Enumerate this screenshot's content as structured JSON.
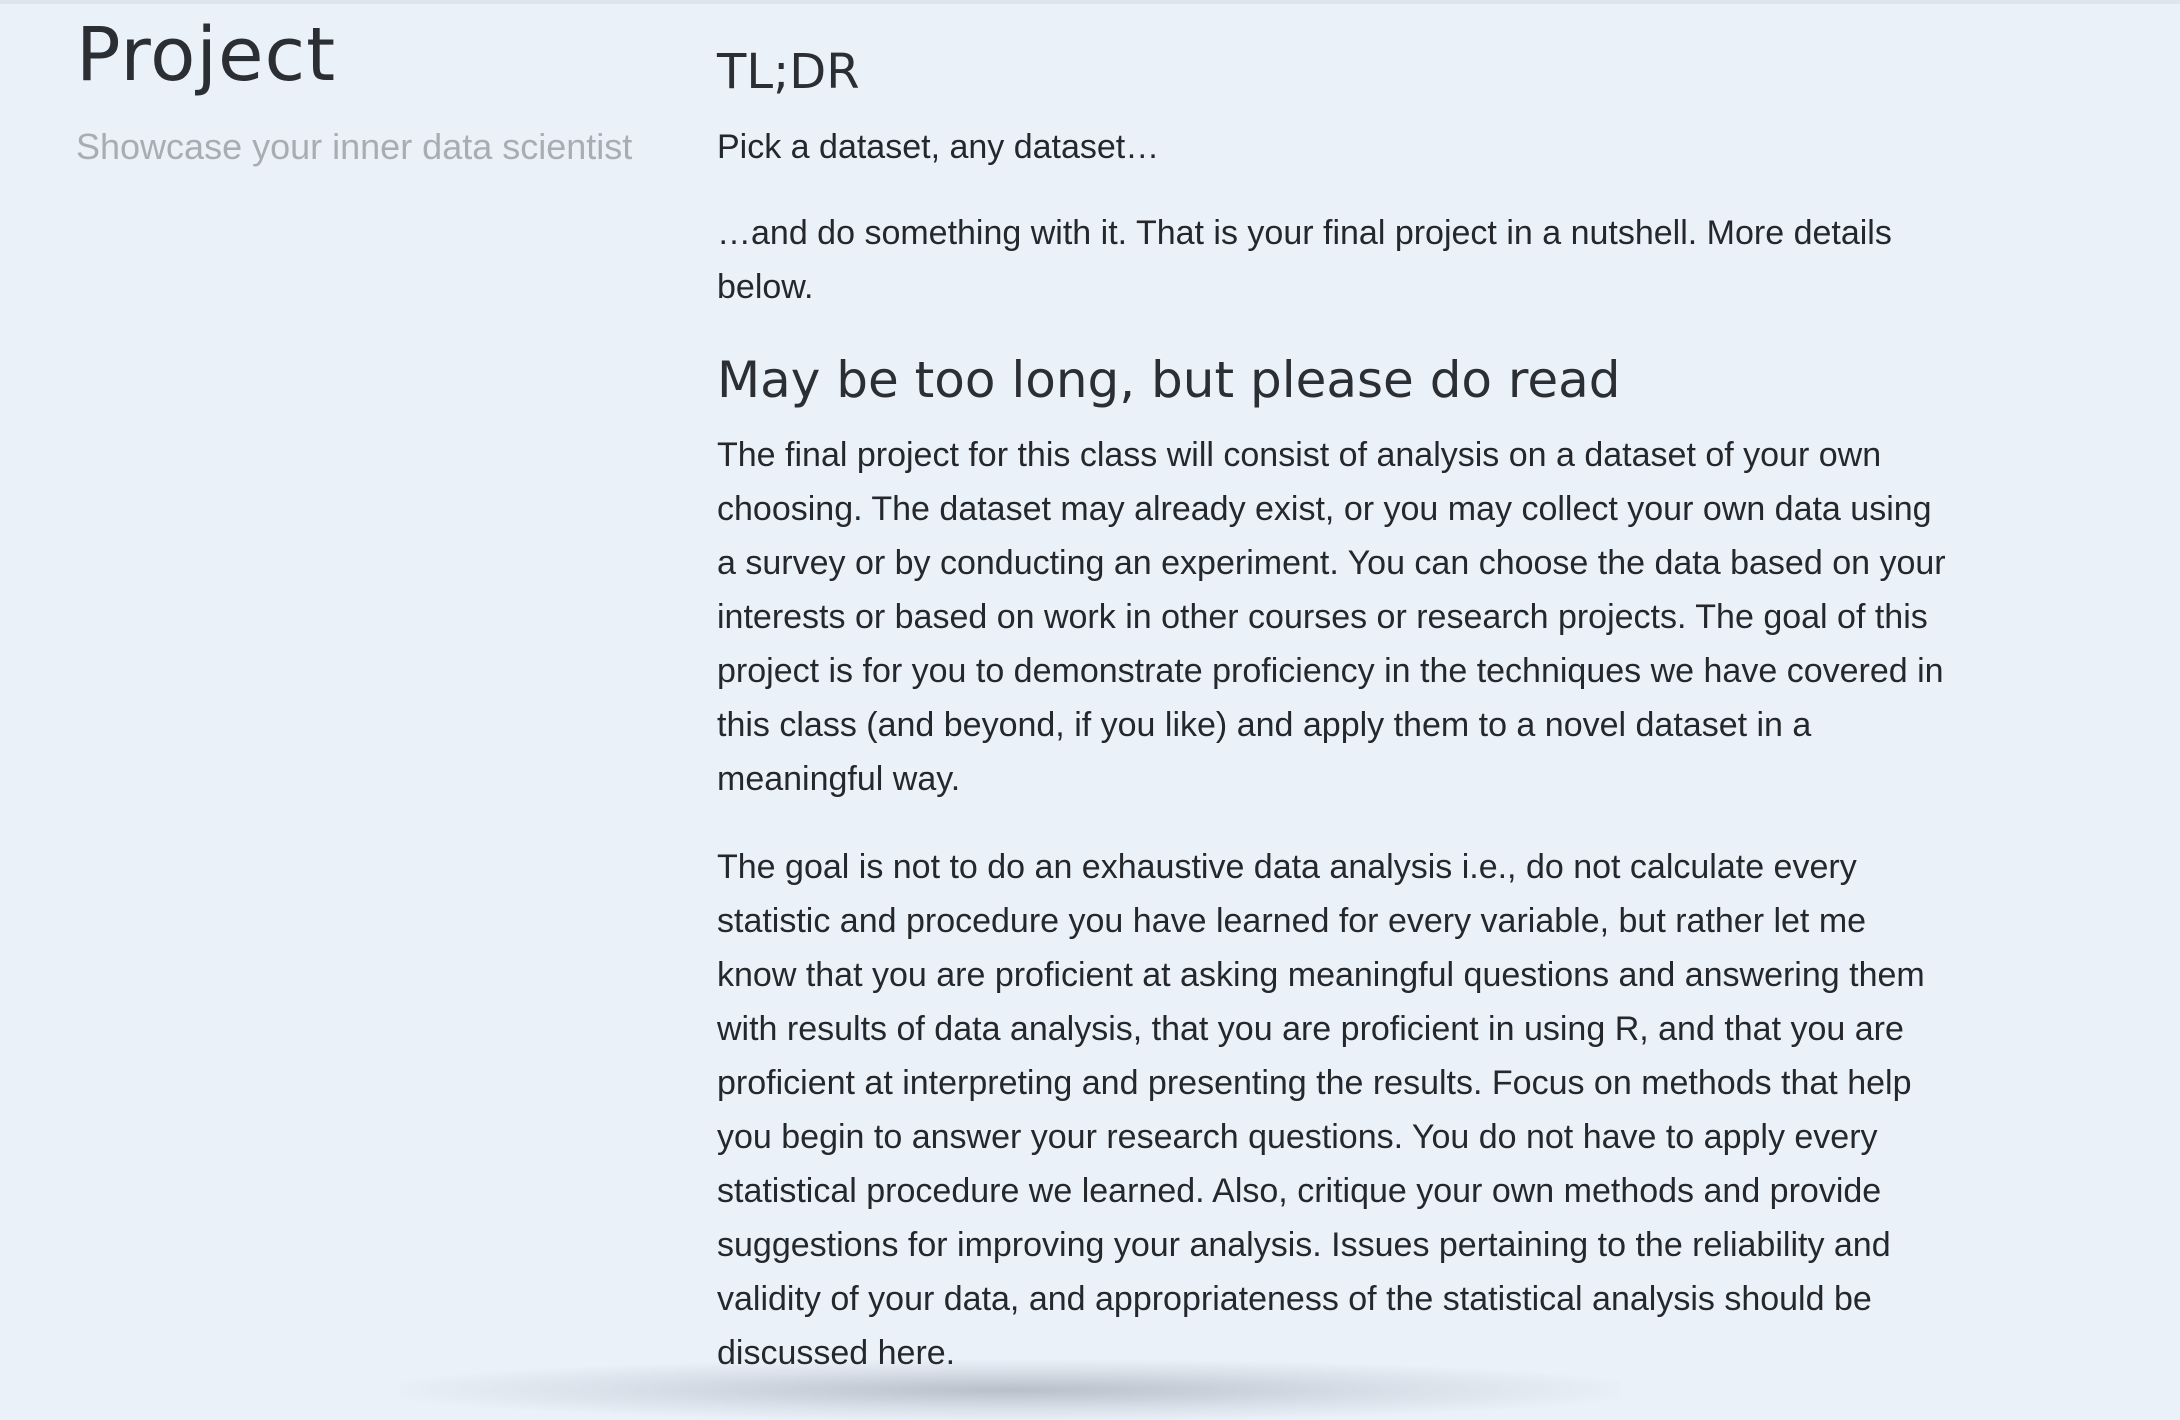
{
  "sidebar": {
    "title": "Project",
    "subtitle": "Showcase your inner data scientist"
  },
  "content": {
    "tldr_heading": "TL;DR",
    "tldr_p1": "Pick a dataset, any dataset…",
    "tldr_p2": "…and do something with it. That is your final project in a nutshell. More details below.",
    "long_heading": "May be too long, but please do read",
    "long_p1": "The final project for this class will consist of analysis on a dataset of your own choosing. The dataset may already exist, or you may collect your own data using a survey or by conducting an experiment. You can choose the data based on your interests or based on work in other courses or research projects. The goal of this project is for you to demonstrate proficiency in the techniques we have covered in this class (and beyond, if you like) and apply them to a novel dataset in a meaningful way.",
    "long_p2": "The goal is not to do an exhaustive data analysis i.e., do not calculate every statistic and procedure you have learned for every variable, but rather let me know that you are proficient at asking meaningful questions and answering them with results of data analysis, that you are proficient in using R, and that you are proficient at interpreting and presenting the results. Focus on methods that help you begin to answer your research questions. You do not have to apply every statistical procedure we learned. Also, critique your own methods and provide suggestions for improving your analysis. Issues pertaining to the reliability and validity of your data, and appropriateness of the statistical analysis should be discussed here."
  }
}
